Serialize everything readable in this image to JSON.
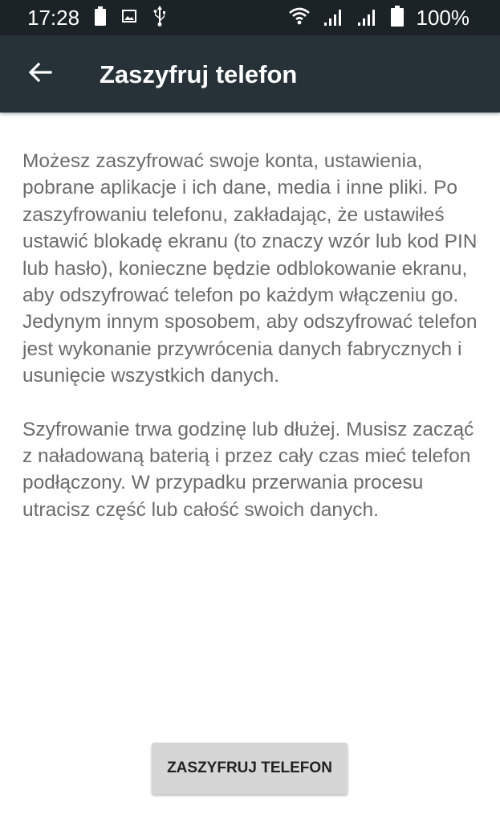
{
  "status_bar": {
    "time": "17:28",
    "battery_percent": "100%",
    "icons": [
      "battery-icon",
      "image-notification-icon",
      "usb-icon",
      "wifi-icon",
      "signal-icon",
      "signal-icon",
      "battery-icon"
    ]
  },
  "app_bar": {
    "back_icon": "arrow-left-icon",
    "title": "Zaszyfruj telefon"
  },
  "body": {
    "paragraph_1": "Możesz zaszyfrować swoje konta, ustawienia, pobrane aplikacje i ich dane, media i inne pliki. Po zaszyfrowaniu telefonu, zakładając, że ustawiłeś ustawić blokadę ekranu (to znaczy wzór lub kod PIN lub hasło), konieczne będzie odblokowanie ekranu, aby odszyfrować telefon po każdym włączeniu go. Jedynym innym sposobem, aby odszyfrować telefon jest wykonanie przywrócenia danych fabrycznych i usunięcie wszystkich danych.",
    "paragraph_2": "Szyfrowanie trwa godzinę lub dłużej. Musisz zacząć z naładowaną baterią i przez cały czas mieć telefon podłączony. W przypadku przerwania procesu utracisz część lub całość swoich danych."
  },
  "actions": {
    "encrypt_label": "ZASZYFRUJ TELEFON"
  },
  "colors": {
    "status_bar_bg": "#1c2326",
    "app_bar_bg": "#263238",
    "body_text": "#6b6b6b",
    "button_bg": "#d6d6d6"
  }
}
